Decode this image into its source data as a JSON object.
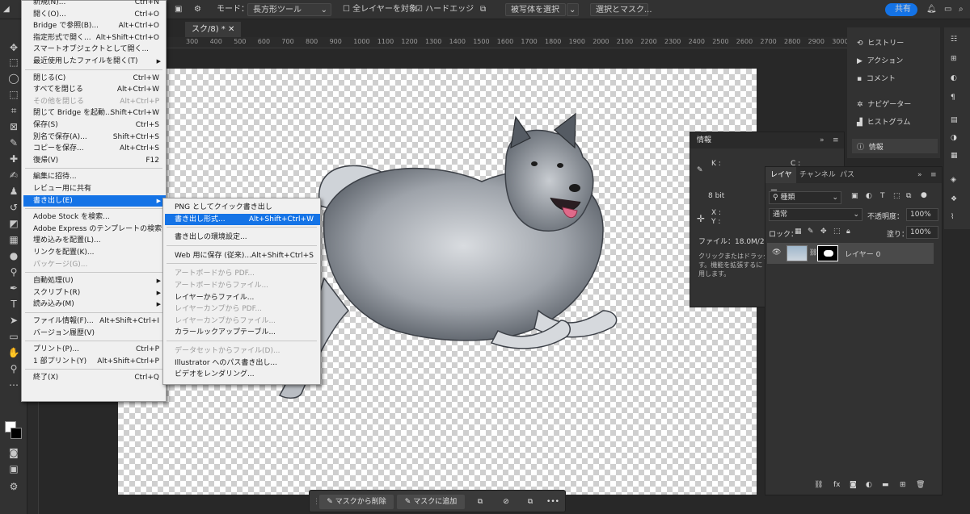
{
  "options_bar": {
    "mode_label": "モード：",
    "mode_value": "長方形ツール",
    "all_layers_label": "全レイヤーを対象",
    "hard_edge_label": "ハードエッジ",
    "select_subject_label": "被写体を選択",
    "select_mask_label": "選択とマスク...",
    "share_label": "共有"
  },
  "document_tab": {
    "title": "スク/8) *"
  },
  "ruler_ticks": [
    "300",
    "400",
    "500",
    "600",
    "700",
    "800",
    "900",
    "1000",
    "1100",
    "1200",
    "1300",
    "1400",
    "1500",
    "1600",
    "1700",
    "1800",
    "1900",
    "2000",
    "2100",
    "2200",
    "2300",
    "2400",
    "2500",
    "2600",
    "2700",
    "2800",
    "2900",
    "3000",
    "3100",
    "3200"
  ],
  "file_menu": {
    "items": [
      {
        "label": "新規(N)...",
        "shortcut": "Ctrl+N",
        "disabled": false,
        "submenu": false
      },
      {
        "label": "開く(O)...",
        "shortcut": "Ctrl+O",
        "disabled": false,
        "submenu": false
      },
      {
        "label": "Bridge で参照(B)...",
        "shortcut": "Alt+Ctrl+O",
        "disabled": false,
        "submenu": false
      },
      {
        "label": "指定形式で開く...",
        "shortcut": "Alt+Shift+Ctrl+O",
        "disabled": false,
        "submenu": false
      },
      {
        "label": "スマートオブジェクトとして開く...",
        "shortcut": "",
        "disabled": false,
        "submenu": false
      },
      {
        "label": "最近使用したファイルを開く(T)",
        "shortcut": "",
        "disabled": false,
        "submenu": true
      },
      {
        "sep": true
      },
      {
        "label": "閉じる(C)",
        "shortcut": "Ctrl+W",
        "disabled": false,
        "submenu": false
      },
      {
        "label": "すべてを閉じる",
        "shortcut": "Alt+Ctrl+W",
        "disabled": false,
        "submenu": false
      },
      {
        "label": "その他を閉じる",
        "shortcut": "Alt+Ctrl+P",
        "disabled": true,
        "submenu": false
      },
      {
        "label": "閉じて Bridge を起動...",
        "shortcut": "Shift+Ctrl+W",
        "disabled": false,
        "submenu": false
      },
      {
        "label": "保存(S)",
        "shortcut": "Ctrl+S",
        "disabled": false,
        "submenu": false
      },
      {
        "label": "別名で保存(A)...",
        "shortcut": "Shift+Ctrl+S",
        "disabled": false,
        "submenu": false
      },
      {
        "label": "コピーを保存...",
        "shortcut": "Alt+Ctrl+S",
        "disabled": false,
        "submenu": false
      },
      {
        "label": "復帰(V)",
        "shortcut": "F12",
        "disabled": false,
        "submenu": false
      },
      {
        "sep": true
      },
      {
        "label": "編集に招待...",
        "shortcut": "",
        "disabled": false,
        "submenu": false
      },
      {
        "label": "レビュー用に共有",
        "shortcut": "",
        "disabled": false,
        "submenu": false
      },
      {
        "label": "書き出し(E)",
        "shortcut": "",
        "disabled": false,
        "submenu": true,
        "highlight": true
      },
      {
        "sep": true
      },
      {
        "label": "Adobe Stock を検索...",
        "shortcut": "",
        "disabled": false,
        "submenu": false
      },
      {
        "label": "Adobe Express のテンプレートの検索...",
        "shortcut": "",
        "disabled": false,
        "submenu": false
      },
      {
        "label": "埋め込みを配置(L)...",
        "shortcut": "",
        "disabled": false,
        "submenu": false
      },
      {
        "label": "リンクを配置(K)...",
        "shortcut": "",
        "disabled": false,
        "submenu": false
      },
      {
        "label": "パッケージ(G)...",
        "shortcut": "",
        "disabled": true,
        "submenu": false
      },
      {
        "sep": true
      },
      {
        "label": "自動処理(U)",
        "shortcut": "",
        "disabled": false,
        "submenu": true
      },
      {
        "label": "スクリプト(R)",
        "shortcut": "",
        "disabled": false,
        "submenu": true
      },
      {
        "label": "読み込み(M)",
        "shortcut": "",
        "disabled": false,
        "submenu": true
      },
      {
        "sep": true
      },
      {
        "label": "ファイル情報(F)...",
        "shortcut": "Alt+Shift+Ctrl+I",
        "disabled": false,
        "submenu": false
      },
      {
        "label": "バージョン履歴(V)",
        "shortcut": "",
        "disabled": false,
        "submenu": false
      },
      {
        "sep": true
      },
      {
        "label": "プリント(P)...",
        "shortcut": "Ctrl+P",
        "disabled": false,
        "submenu": false
      },
      {
        "label": "1 部プリント(Y)",
        "shortcut": "Alt+Shift+Ctrl+P",
        "disabled": false,
        "submenu": false
      },
      {
        "sep": true
      },
      {
        "label": "終了(X)",
        "shortcut": "Ctrl+Q",
        "disabled": false,
        "submenu": false
      }
    ]
  },
  "export_menu": {
    "items": [
      {
        "label": "PNG としてクイック書き出し",
        "shortcut": "",
        "disabled": false
      },
      {
        "label": "書き出し形式...",
        "shortcut": "Alt+Shift+Ctrl+W",
        "disabled": false,
        "highlight": true
      },
      {
        "sep": true
      },
      {
        "label": "書き出しの環境設定...",
        "shortcut": "",
        "disabled": false
      },
      {
        "sep": true
      },
      {
        "label": "Web 用に保存 (従来)...",
        "shortcut": "Alt+Shift+Ctrl+S",
        "disabled": false
      },
      {
        "sep": true
      },
      {
        "label": "アートボードから PDF...",
        "shortcut": "",
        "disabled": true
      },
      {
        "label": "アートボードからファイル...",
        "shortcut": "",
        "disabled": true
      },
      {
        "label": "レイヤーからファイル...",
        "shortcut": "",
        "disabled": false
      },
      {
        "label": "レイヤーカンプから PDF...",
        "shortcut": "",
        "disabled": true
      },
      {
        "label": "レイヤーカンプからファイル...",
        "shortcut": "",
        "disabled": true
      },
      {
        "label": "カラールックアップテーブル...",
        "shortcut": "",
        "disabled": false
      },
      {
        "sep": true
      },
      {
        "label": "データセットからファイル(D)...",
        "shortcut": "",
        "disabled": true
      },
      {
        "label": "Illustrator へのパス書き出し...",
        "shortcut": "",
        "disabled": false
      },
      {
        "label": "ビデオをレンダリング...",
        "shortcut": "",
        "disabled": false
      }
    ]
  },
  "right_dock": {
    "items": [
      {
        "label": "ヒストリー",
        "icon": "history-icon"
      },
      {
        "label": "アクション",
        "icon": "play-icon"
      },
      {
        "label": "コメント",
        "icon": "comment-icon"
      },
      {
        "label": "ナビゲーター",
        "icon": "navigator-icon"
      },
      {
        "label": "ヒストグラム",
        "icon": "histogram-icon"
      },
      {
        "label": "情報",
        "icon": "info-icon"
      }
    ]
  },
  "info_panel": {
    "title": "情報",
    "k_label": "K :",
    "c_label": "C :",
    "bit_label": "8 bit",
    "x_label": "X :",
    "y_label": "Y :",
    "file_label": "ファイル：18.0M/24.0M",
    "help_text_1": "クリックまたはドラッグし",
    "help_text_2": "す。機能を拡張するに",
    "help_text_3": "用します。"
  },
  "layers_panel": {
    "tabs": [
      "レイヤー",
      "チャンネル",
      "パス"
    ],
    "kind_label": "種類",
    "blend_mode": "通常",
    "opacity_label": "不透明度：",
    "opacity_value": "100%",
    "lock_label": "ロック：",
    "fill_label": "塗り：",
    "fill_value": "100%",
    "layer_name": "レイヤー 0"
  },
  "bottom_bar": {
    "remove_from_mask": "マスクから削除",
    "add_to_mask": "マスクに追加",
    "more": "•••"
  },
  "colors": {
    "accent": "#1473e6",
    "app_bg": "#282828",
    "panel_bg": "#323232",
    "menu_bg": "#f0f0f0"
  }
}
